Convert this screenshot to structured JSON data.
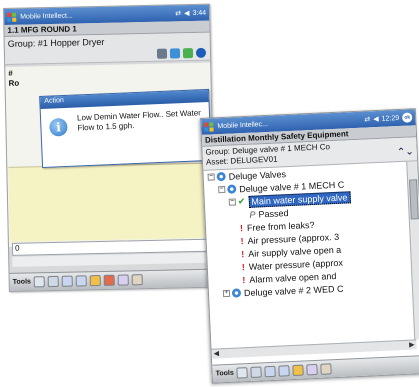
{
  "left_screen": {
    "titlebar": {
      "app_title": "Mobile Intellect...",
      "time": "3:44"
    },
    "header": "1.1 MFG ROUND 1",
    "group": "Group: #1 Hopper Dryer",
    "side_letters": [
      "#",
      "Ro"
    ],
    "input_value": "0",
    "tools_label": "Tools",
    "popup": {
      "title": "Action",
      "message": "Low Demin Water Flow.. Set Water Flow to 1.5 gph."
    }
  },
  "right_screen": {
    "titlebar": {
      "app_title": "Mobile Intellec...",
      "time": "12:29"
    },
    "header": "Distillation Monthly Safety Equipment",
    "group": "Group:  Deluge valve # 1 MECH Co",
    "asset": "Asset:  DELUGEV01",
    "nav_arrows": "⌃⌄",
    "tree": {
      "root": "Deluge Valves",
      "valve1": "Deluge valve # 1 MECH C",
      "selected": "Main water supply valve",
      "passed": "Passed",
      "items": [
        "Free from leaks?",
        "Air pressure (approx. 3",
        "Air supply valve open a",
        "Water pressure (approx",
        "Alarm valve open and"
      ],
      "valve2": "Deluge valve # 2 WED C"
    },
    "tools_label": "Tools"
  },
  "colors": {
    "titlebar": "#2e62b0",
    "selected_row": "#2f66c2",
    "alert": "#d42020",
    "check": "#2a9b2a",
    "yellow_pane": "#f5f2c4"
  },
  "icons": [
    "windows-flag-icon",
    "info-icon",
    "gear-icon",
    "check-icon",
    "exclamation-icon",
    "pass-icon"
  ]
}
